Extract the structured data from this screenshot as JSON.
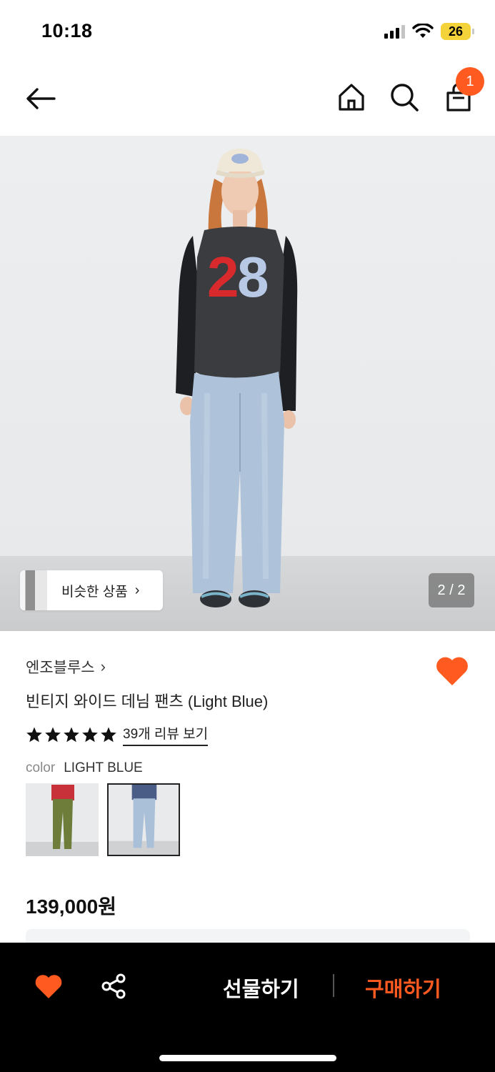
{
  "status_bar": {
    "time": "10:18",
    "battery": "26"
  },
  "nav": {
    "cart_count": "1"
  },
  "hero": {
    "similar_label": "비슷한 상품",
    "page_indicator": "2 / 2"
  },
  "product": {
    "brand": "엔조블루스",
    "title": "빈티지 와이드 데님 팬츠 (Light Blue)",
    "rating_stars": 5,
    "review_link": "39개 리뷰 보기",
    "color_key": "color",
    "color_value": "LIGHT BLUE",
    "swatches": [
      {
        "name": "green variant",
        "selected": false
      },
      {
        "name": "light blue variant",
        "selected": true
      }
    ],
    "price": "139,000원"
  },
  "bottom_bar": {
    "gift_label": "선물하기",
    "buy_label": "구매하기"
  },
  "colors": {
    "accent": "#ff5a1f",
    "bottom_bar": "#000000"
  }
}
